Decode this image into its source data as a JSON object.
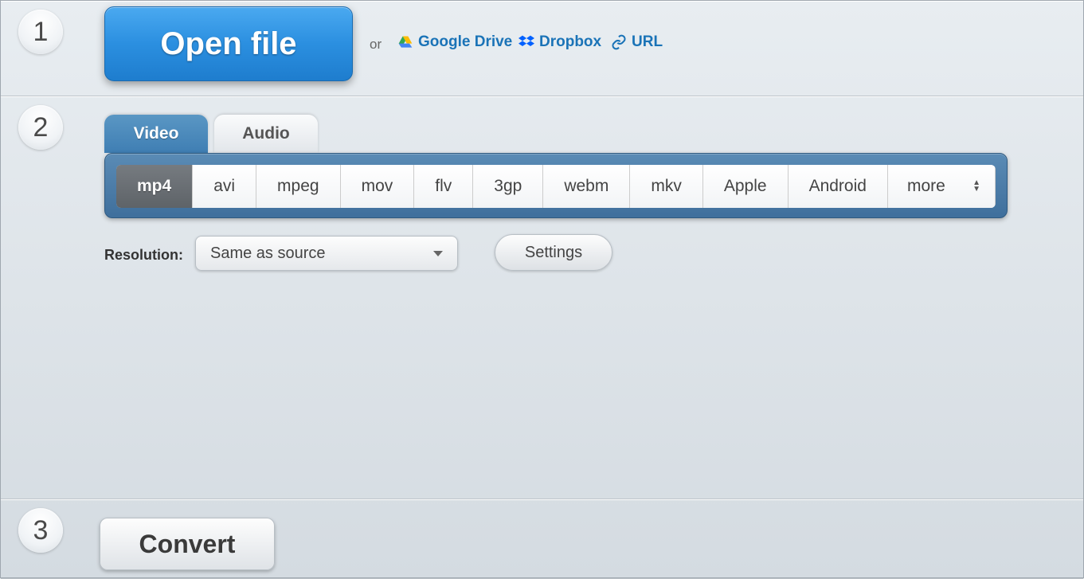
{
  "steps": {
    "s1": "1",
    "s2": "2",
    "s3": "3"
  },
  "step1": {
    "open_file_label": "Open file",
    "or": "or",
    "providers": {
      "gdrive": "Google Drive",
      "dropbox": "Dropbox",
      "url": "URL"
    }
  },
  "step2": {
    "tabs": {
      "video": "Video",
      "audio": "Audio"
    },
    "active_tab": "video",
    "formats": [
      "mp4",
      "avi",
      "mpeg",
      "mov",
      "flv",
      "3gp",
      "webm",
      "mkv",
      "Apple",
      "Android",
      "more"
    ],
    "selected_format": "mp4",
    "resolution_label": "Resolution:",
    "resolution_value": "Same as source",
    "settings_label": "Settings"
  },
  "step3": {
    "convert_label": "Convert"
  }
}
